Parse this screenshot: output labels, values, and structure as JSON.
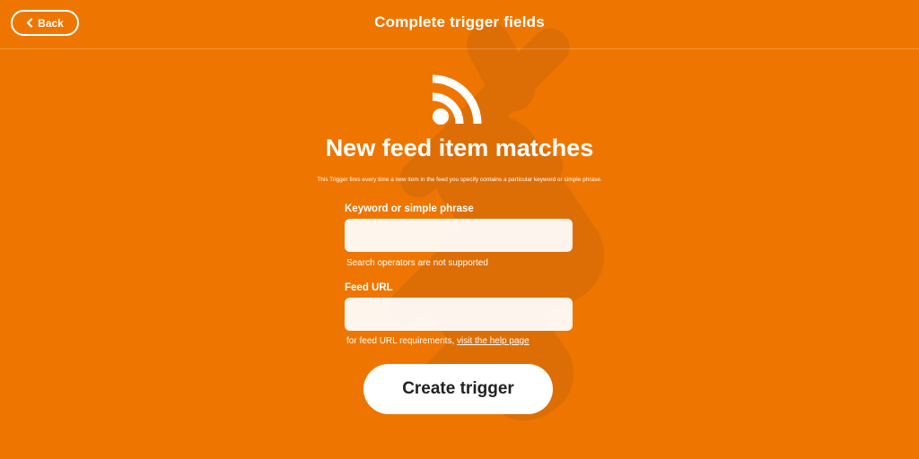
{
  "header": {
    "back_label": "Back",
    "title": "Complete trigger fields"
  },
  "trigger": {
    "icon": "rss-feed-icon",
    "title": "New feed item matches",
    "description": "This Trigger fires every time a new item in the feed you specify contains a particular keyword or simple phrase."
  },
  "fields": {
    "keyword": {
      "label": "Keyword or simple phrase",
      "value": "",
      "help": "Search operators are not supported"
    },
    "feed_url": {
      "label": "Feed URL",
      "value": "",
      "help_text": "for feed URL requirements, ",
      "help_link": "visit the help page"
    }
  },
  "actions": {
    "create_label": "Create trigger"
  },
  "colors": {
    "background": "#EE7600",
    "watermark": "#D96A06",
    "text": "#FFFFFF",
    "button_text": "#222222"
  }
}
